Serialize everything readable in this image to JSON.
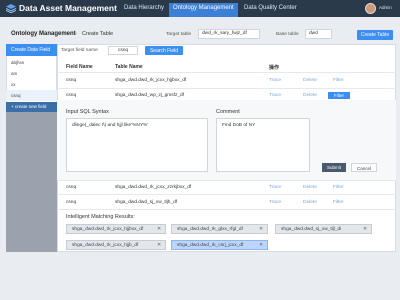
{
  "app": {
    "title": "Data Asset Management"
  },
  "nav": {
    "items": [
      "Data Hierarchy",
      "Ontology Management",
      "Data Quality Center"
    ],
    "active_index": 1
  },
  "user": {
    "name": "Admin"
  },
  "header": {
    "breadcrumb_root": "Ontology Management",
    "breadcrumb_sep": "›",
    "breadcrumb_current": "Create Table",
    "target_table_label": "Target table",
    "target_table_value": "dwd_rk_sary_fwjz_df",
    "base_table_label": "Base table",
    "base_table_value": "dwd",
    "create_table_button": "Create Table"
  },
  "sidebar": {
    "head": "Create Data Field",
    "items": [
      "abjhsn",
      "am",
      "xx",
      "csnq"
    ],
    "selected_index": 3,
    "new_field": "+ create new field"
  },
  "search": {
    "label": "Target field name",
    "value": "csnq",
    "button": "Search Field"
  },
  "table": {
    "headers": [
      "Field Name",
      "Table Name",
      "操作"
    ],
    "rows": [
      {
        "field": "csnq",
        "table": "shga_dwd.dwd_rk_jcxx_hjjbxx_df",
        "actions": [
          "Trace",
          "Delete",
          "Filter"
        ]
      },
      {
        "field": "csnq",
        "table": "shga_dwd.dwd_wp_zj_gmsfz_df",
        "actions": [
          "Trace",
          "Delete",
          "Filter"
        ]
      },
      {
        "field": "csnq",
        "table": "shga_dwd.dwd_rk_jcxx_zzrkjbxx_df",
        "actions": [
          "Trace",
          "Delete",
          "Filter"
        ]
      },
      {
        "field": "csnq",
        "table": "shga_dwd.dwd_sj_xw_tljh_df",
        "actions": [
          "Trace",
          "Delete",
          "Filter"
        ]
      }
    ],
    "active_filter_row": 1
  },
  "expand": {
    "sql_label": "Input SQL Syntax",
    "sql_value": "dlinge(_dalec t\\) and hjjl like'%NY%'",
    "comment_label": "Comment",
    "comment_value": "Find DoB of NY",
    "submit": "Submit",
    "cancel": "Cancel"
  },
  "results": {
    "label": "Intelligent Matching Results:",
    "chips": [
      {
        "text": "shga_dwd.dwd_rk_jcxx_hjjbxx_df",
        "selected": false
      },
      {
        "text": "shga_dwd.dwd_rk_glxx_rfgl_df",
        "selected": false
      },
      {
        "text": "shga_dwd.dwd_sj_xw_tljl_di",
        "selected": false
      },
      {
        "text": "shga_dwd.dwd_rk_jcxx_hjjb_df",
        "selected": false
      },
      {
        "text": "shga_dwd.dwd_rk_csrj_jcxx_df",
        "selected": true
      }
    ],
    "remove_glyph": "✕"
  },
  "colors": {
    "topbar": "#2b3a4a",
    "accent": "#3c8ef0",
    "sidebar_new": "#3c6ea8",
    "chip_selected": "#bcd6fb"
  }
}
